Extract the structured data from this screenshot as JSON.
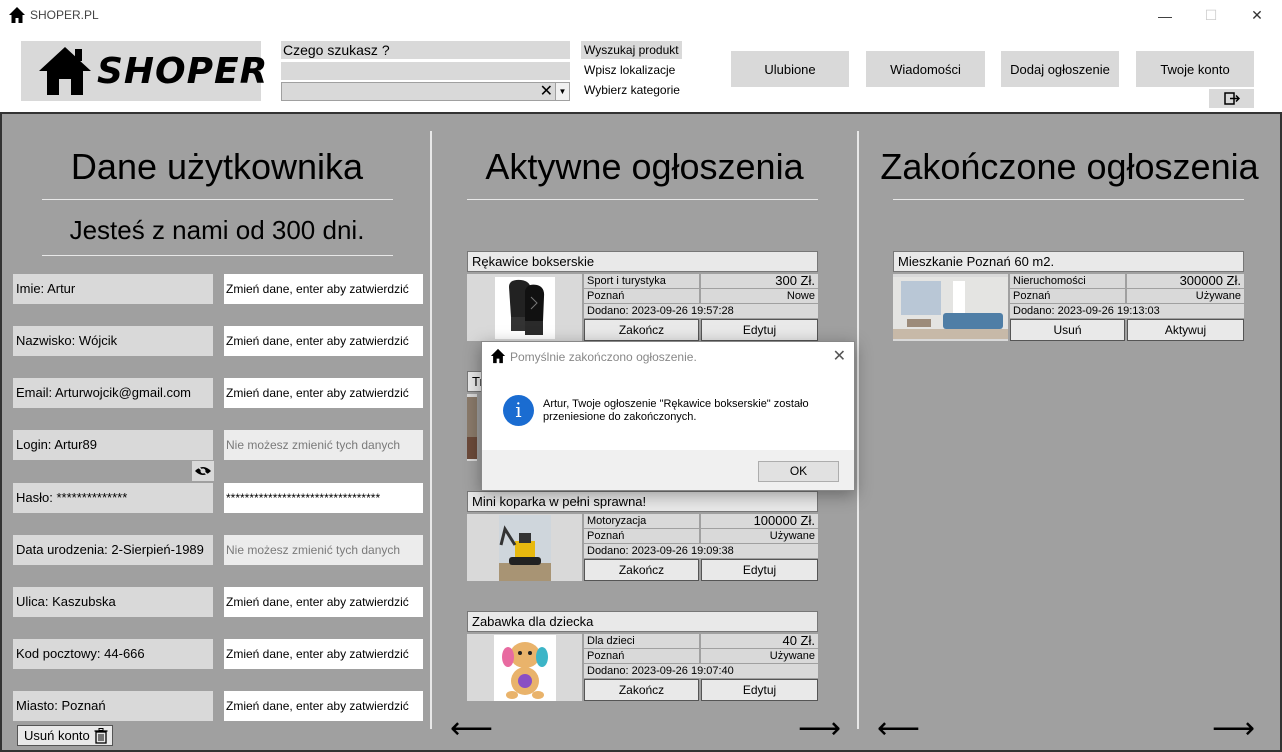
{
  "window": {
    "title": "SHOPER.PL",
    "min": "—",
    "max": "☐",
    "close": "✕"
  },
  "header": {
    "logo_text": "SHOPER",
    "search_placeholder": "Czego szukasz ?",
    "clear_symbol": "✕",
    "dropdown_symbol": "▼",
    "search_label": "Wyszukaj produkt",
    "location_label": "Wpisz lokalizacje",
    "category_label": "Wybierz kategorie",
    "buttons": [
      "Ulubione",
      "Wiadomości",
      "Dodaj ogłoszenie",
      "Twoje konto"
    ]
  },
  "user": {
    "title": "Dane użytkownika",
    "subtitle": "Jesteś z nami od 300 dni.",
    "fields": [
      {
        "label": "Imie: Artur",
        "input": "Zmień dane, enter aby zatwierdzić",
        "disabled": false
      },
      {
        "label": "Nazwisko: Wójcik",
        "input": "Zmień dane, enter aby zatwierdzić",
        "disabled": false
      },
      {
        "label": "Email: Arturwojcik@gmail.com",
        "input": "Zmień dane, enter aby zatwierdzić",
        "disabled": false
      },
      {
        "label": "Login: Artur89",
        "input": "Nie możesz zmienić tych danych",
        "disabled": true
      },
      {
        "label": "Hasło: **************",
        "input": "*********************************",
        "disabled": false
      },
      {
        "label": "Data urodzenia: 2-Sierpień-1989",
        "input": "Nie możesz zmienić tych danych",
        "disabled": true
      },
      {
        "label": "Ulica: Kaszubska",
        "input": "Zmień dane, enter aby zatwierdzić",
        "disabled": false
      },
      {
        "label": "Kod pocztowy: 44-666",
        "input": "Zmień dane, enter aby zatwierdzić",
        "disabled": false
      },
      {
        "label": "Miasto: Poznań",
        "input": "Zmień dane, enter aby zatwierdzić",
        "disabled": false
      }
    ],
    "delete_label": "Usuń konto"
  },
  "active": {
    "title": "Aktywne ogłoszenia",
    "cards": [
      {
        "title": "Rękawice bokserskie",
        "category": "Sport i turystyka",
        "price": "300 Zł.",
        "city": "Poznań",
        "condition": "Nowe",
        "added": "Dodano: 2023-09-26 19:57:28",
        "btn1": "Zakończ",
        "btn2": "Edytuj",
        "image": "gloves"
      },
      {
        "title": "Tr",
        "category": "",
        "price": "",
        "city": "",
        "condition": "",
        "added": "",
        "btn1": "",
        "btn2": "",
        "image": "partial"
      },
      {
        "title": "Mini koparka w pełni sprawna!",
        "category": "Motoryzacja",
        "price": "100000 Zł.",
        "city": "Poznań",
        "condition": "Używane",
        "added": "Dodano: 2023-09-26 19:09:38",
        "btn1": "Zakończ",
        "btn2": "Edytuj",
        "image": "excavator"
      },
      {
        "title": "Zabawka dla dziecka",
        "category": "Dla dzieci",
        "price": "40 Zł.",
        "city": "Poznań",
        "condition": "Używane",
        "added": "Dodano: 2023-09-26 19:07:40",
        "btn1": "Zakończ",
        "btn2": "Edytuj",
        "image": "toy"
      }
    ],
    "arrow_left": "⟵",
    "arrow_right": "⟶"
  },
  "finished": {
    "title": "Zakończone ogłoszenia",
    "cards": [
      {
        "title": "Mieszkanie Poznań 60 m2.",
        "category": "Nieruchomości",
        "price": "300000 Zł.",
        "city": "Poznań",
        "condition": "Używane",
        "added": "Dodano: 2023-09-26 19:13:03",
        "btn1": "Usuń",
        "btn2": "Aktywuj",
        "image": "apartment"
      }
    ],
    "arrow_left": "⟵",
    "arrow_right": "⟶"
  },
  "dialog": {
    "title": "Pomyślnie zakończono ogłoszenie.",
    "icon_letter": "i",
    "message_line1": "Artur, Twoje ogłoszenie \"Rękawice bokserskie\" zostało",
    "message_line2": "przeniesione do zakończonych.",
    "ok_label": "OK",
    "close": "✕"
  }
}
